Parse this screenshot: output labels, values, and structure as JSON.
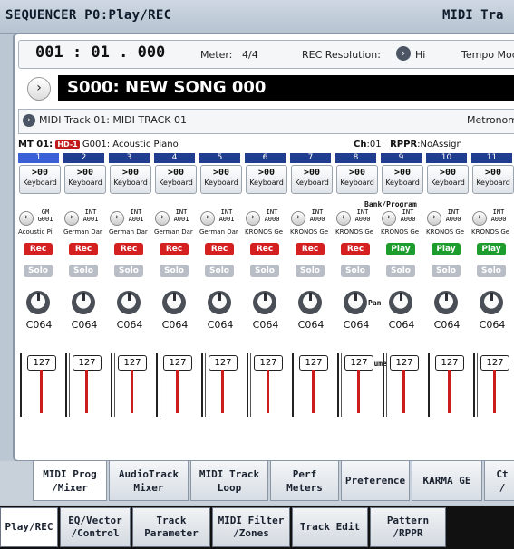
{
  "header": {
    "title": "SEQUENCER P0:Play/REC",
    "right": "MIDI Tra"
  },
  "locate": {
    "position": "001 : 01 . 000",
    "meter_label": "Meter:",
    "meter_value": "4/4",
    "rec_res_label": "REC Resolution:",
    "rec_res_value": "Hi",
    "tempo_label": "Tempo Mode"
  },
  "song": {
    "name": "S000: NEW SONG 000"
  },
  "track_select": {
    "label": "MIDI Track 01: MIDI TRACK 01",
    "metronome": "Metronome"
  },
  "mt": {
    "prefix": "MT 01:",
    "hd": "HD-1",
    "program": "G001: Acoustic Piano",
    "ch_label": "Ch",
    "ch": ":01",
    "rppr_label": "RPPR",
    "rppr": ":NoAssign"
  },
  "sections": {
    "bank_program": "Bank/Program",
    "pan": "Pan",
    "volume": "Volume"
  },
  "tracks": [
    {
      "num": "1",
      "kb_top": ">00",
      "kb_bot": "Keyboard",
      "bank": "GM",
      "prog": "G001",
      "name": "Acoustic Pi",
      "rec": "Rec",
      "solo": "Solo",
      "pan": "C064",
      "vol": "127"
    },
    {
      "num": "2",
      "kb_top": ">00",
      "kb_bot": "Keyboard",
      "bank": "INT",
      "prog": "A001",
      "name": "German Dar",
      "rec": "Rec",
      "solo": "Solo",
      "pan": "C064",
      "vol": "127"
    },
    {
      "num": "3",
      "kb_top": ">00",
      "kb_bot": "Keyboard",
      "bank": "INT",
      "prog": "A001",
      "name": "German Dar",
      "rec": "Rec",
      "solo": "Solo",
      "pan": "C064",
      "vol": "127"
    },
    {
      "num": "4",
      "kb_top": ">00",
      "kb_bot": "Keyboard",
      "bank": "INT",
      "prog": "A001",
      "name": "German Dar",
      "rec": "Rec",
      "solo": "Solo",
      "pan": "C064",
      "vol": "127"
    },
    {
      "num": "5",
      "kb_top": ">00",
      "kb_bot": "Keyboard",
      "bank": "INT",
      "prog": "A001",
      "name": "German Dar",
      "rec": "Rec",
      "solo": "Solo",
      "pan": "C064",
      "vol": "127"
    },
    {
      "num": "6",
      "kb_top": ">00",
      "kb_bot": "Keyboard",
      "bank": "INT",
      "prog": "A000",
      "name": "KRONOS Ge",
      "rec": "Rec",
      "solo": "Solo",
      "pan": "C064",
      "vol": "127"
    },
    {
      "num": "7",
      "kb_top": ">00",
      "kb_bot": "Keyboard",
      "bank": "INT",
      "prog": "A000",
      "name": "KRONOS Ge",
      "rec": "Rec",
      "solo": "Solo",
      "pan": "C064",
      "vol": "127"
    },
    {
      "num": "8",
      "kb_top": ">00",
      "kb_bot": "Keyboard",
      "bank": "INT",
      "prog": "A000",
      "name": "KRONOS Ge",
      "rec": "Rec",
      "solo": "Solo",
      "pan": "C064",
      "vol": "127"
    },
    {
      "num": "9",
      "kb_top": ">00",
      "kb_bot": "Keyboard",
      "bank": "INT",
      "prog": "A000",
      "name": "KRONOS Ge",
      "rec": "Play",
      "solo": "Solo",
      "pan": "C064",
      "vol": "127"
    },
    {
      "num": "10",
      "kb_top": ">00",
      "kb_bot": "Keyboard",
      "bank": "INT",
      "prog": "A000",
      "name": "KRONOS Ge",
      "rec": "Play",
      "solo": "Solo",
      "pan": "C064",
      "vol": "127"
    },
    {
      "num": "11",
      "kb_top": ">00",
      "kb_bot": "Keyboard",
      "bank": "INT",
      "prog": "A000",
      "name": "KRONOS Ge",
      "rec": "Play",
      "solo": "Solo",
      "pan": "C064",
      "vol": "127"
    }
  ],
  "tabs_upper": [
    {
      "label": "MIDI Prog\n/Mixer",
      "selected": true
    },
    {
      "label": "AudioTrack\nMixer",
      "selected": false
    },
    {
      "label": "MIDI Track\nLoop",
      "selected": false
    },
    {
      "label": "Perf\nMeters",
      "selected": false
    },
    {
      "label": "Preference",
      "selected": false
    },
    {
      "label": "KARMA GE",
      "selected": false
    },
    {
      "label": "Ct\n/",
      "selected": false
    }
  ],
  "tabs_lower": [
    {
      "label": "Play/REC",
      "selected": true
    },
    {
      "label": "EQ/Vector\n/Control",
      "selected": false
    },
    {
      "label": "Track\nParameter",
      "selected": false
    },
    {
      "label": "MIDI Filter\n/Zones",
      "selected": false
    },
    {
      "label": "Track Edit",
      "selected": false
    },
    {
      "label": "Pattern\n/RPPR",
      "selected": false
    }
  ]
}
